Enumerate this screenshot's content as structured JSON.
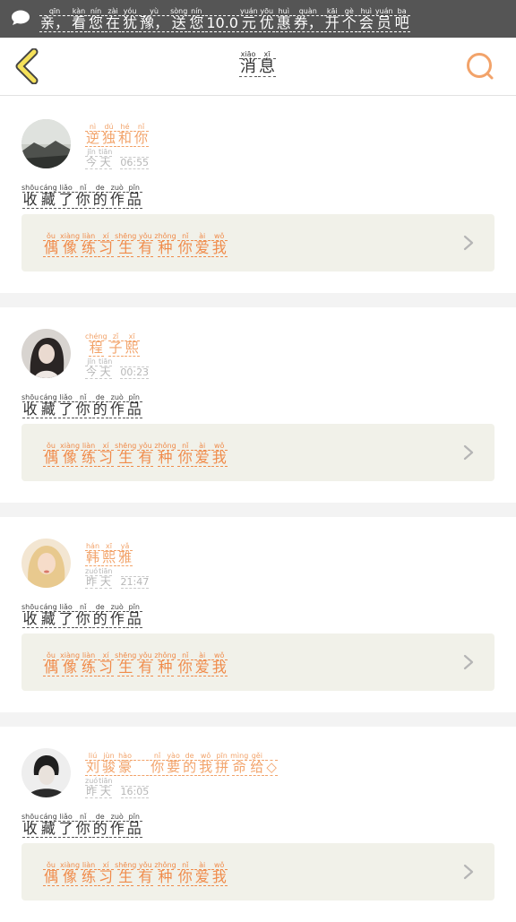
{
  "colors": {
    "topbar_bg": "#555555",
    "accent_orange": "#f08b4a",
    "back_arrow_yellow": "#f5e15a",
    "card_inner_bg": "#f1f1e9",
    "separator": "#f3f3f3"
  },
  "topbar": {
    "icon": "chat-bubble-icon",
    "text": [
      {
        "py": "qīn",
        "hz": "亲，"
      },
      {
        "py": "kàn",
        "hz": "看"
      },
      {
        "py": "nín",
        "hz": "您"
      },
      {
        "py": "zài",
        "hz": "在"
      },
      {
        "py": "yóu",
        "hz": "犹"
      },
      {
        "py": "yù",
        "hz": "豫，"
      },
      {
        "py": "sòng",
        "hz": "送"
      },
      {
        "py": "nín",
        "hz": "您"
      },
      {
        "py": "",
        "hz": "10.0"
      },
      {
        "py": "yuán",
        "hz": "元"
      },
      {
        "py": "yōu",
        "hz": "优"
      },
      {
        "py": "huì",
        "hz": "惠"
      },
      {
        "py": "quàn",
        "hz": "券，"
      },
      {
        "py": "kāi",
        "hz": "开"
      },
      {
        "py": "gè",
        "hz": "个"
      },
      {
        "py": "huì",
        "hz": "会"
      },
      {
        "py": "yuán",
        "hz": "员"
      },
      {
        "py": "ba",
        "hz": "吧"
      }
    ]
  },
  "header": {
    "back_icon": "back-chevron-icon",
    "search_icon": "search-icon",
    "title": [
      {
        "py": "xiāo",
        "hz": "消"
      },
      {
        "py": "xī",
        "hz": "息"
      }
    ]
  },
  "messages": [
    {
      "username": [
        {
          "py": "nì",
          "hz": "逆"
        },
        {
          "py": "dú",
          "hz": "独"
        },
        {
          "py": "hé",
          "hz": "和"
        },
        {
          "py": "nǐ",
          "hz": "你"
        }
      ],
      "day": [
        {
          "py": "jīn",
          "hz": "今"
        },
        {
          "py": "tiān",
          "hz": "天"
        }
      ],
      "time": "06:55",
      "action": [
        {
          "py": "shōu",
          "hz": "收"
        },
        {
          "py": "cáng",
          "hz": "藏"
        },
        {
          "py": "liǎo",
          "hz": "了"
        },
        {
          "py": "nǐ",
          "hz": "你"
        },
        {
          "py": "de",
          "hz": "的"
        },
        {
          "py": "zuò",
          "hz": "作"
        },
        {
          "py": "pǐn",
          "hz": "品"
        }
      ],
      "work": [
        {
          "py": "ǒu",
          "hz": "偶"
        },
        {
          "py": "xiàng",
          "hz": "像"
        },
        {
          "py": "liàn",
          "hz": "练"
        },
        {
          "py": "xí",
          "hz": "习"
        },
        {
          "py": "shēng",
          "hz": "生"
        },
        {
          "py": "yǒu",
          "hz": "有"
        },
        {
          "py": "zhǒng",
          "hz": "种"
        },
        {
          "py": "nǐ",
          "hz": "你"
        },
        {
          "py": "ài",
          "hz": "爱"
        },
        {
          "py": "wǒ",
          "hz": "我"
        }
      ]
    },
    {
      "username": [
        {
          "py": "chéng",
          "hz": "程"
        },
        {
          "py": "zǐ",
          "hz": "子"
        },
        {
          "py": "xī",
          "hz": "熙"
        }
      ],
      "day": [
        {
          "py": "jīn",
          "hz": "今"
        },
        {
          "py": "tiān",
          "hz": "天"
        }
      ],
      "time": "00:23",
      "action": [
        {
          "py": "shōu",
          "hz": "收"
        },
        {
          "py": "cáng",
          "hz": "藏"
        },
        {
          "py": "liǎo",
          "hz": "了"
        },
        {
          "py": "nǐ",
          "hz": "你"
        },
        {
          "py": "de",
          "hz": "的"
        },
        {
          "py": "zuò",
          "hz": "作"
        },
        {
          "py": "pǐn",
          "hz": "品"
        }
      ],
      "work": [
        {
          "py": "ǒu",
          "hz": "偶"
        },
        {
          "py": "xiàng",
          "hz": "像"
        },
        {
          "py": "liàn",
          "hz": "练"
        },
        {
          "py": "xí",
          "hz": "习"
        },
        {
          "py": "shēng",
          "hz": "生"
        },
        {
          "py": "yǒu",
          "hz": "有"
        },
        {
          "py": "zhǒng",
          "hz": "种"
        },
        {
          "py": "nǐ",
          "hz": "你"
        },
        {
          "py": "ài",
          "hz": "爱"
        },
        {
          "py": "wǒ",
          "hz": "我"
        }
      ]
    },
    {
      "username": [
        {
          "py": "hán",
          "hz": "韩"
        },
        {
          "py": "xī",
          "hz": "熙"
        },
        {
          "py": "yǎ",
          "hz": "雅"
        }
      ],
      "day": [
        {
          "py": "zuó",
          "hz": "昨"
        },
        {
          "py": "tiān",
          "hz": "天"
        }
      ],
      "time": "21:47",
      "action": [
        {
          "py": "shōu",
          "hz": "收"
        },
        {
          "py": "cáng",
          "hz": "藏"
        },
        {
          "py": "liǎo",
          "hz": "了"
        },
        {
          "py": "nǐ",
          "hz": "你"
        },
        {
          "py": "de",
          "hz": "的"
        },
        {
          "py": "zuò",
          "hz": "作"
        },
        {
          "py": "pǐn",
          "hz": "品"
        }
      ],
      "work": [
        {
          "py": "ǒu",
          "hz": "偶"
        },
        {
          "py": "xiàng",
          "hz": "像"
        },
        {
          "py": "liàn",
          "hz": "练"
        },
        {
          "py": "xí",
          "hz": "习"
        },
        {
          "py": "shēng",
          "hz": "生"
        },
        {
          "py": "yǒu",
          "hz": "有"
        },
        {
          "py": "zhǒng",
          "hz": "种"
        },
        {
          "py": "nǐ",
          "hz": "你"
        },
        {
          "py": "ài",
          "hz": "爱"
        },
        {
          "py": "wǒ",
          "hz": "我"
        }
      ]
    },
    {
      "username": [
        {
          "py": "liú",
          "hz": "刘"
        },
        {
          "py": "jùn",
          "hz": "骏"
        },
        {
          "py": "hào",
          "hz": "豪"
        },
        {
          "py": "",
          "hz": "　"
        },
        {
          "py": "nǐ",
          "hz": "你"
        },
        {
          "py": "yào",
          "hz": "要"
        },
        {
          "py": "de",
          "hz": "的"
        },
        {
          "py": "wǒ",
          "hz": "我"
        },
        {
          "py": "pīn",
          "hz": "拼"
        },
        {
          "py": "mìng",
          "hz": "命"
        },
        {
          "py": "gěi",
          "hz": "给"
        },
        {
          "py": "",
          "hz": "◇"
        }
      ],
      "day": [
        {
          "py": "zuó",
          "hz": "昨"
        },
        {
          "py": "tiān",
          "hz": "天"
        }
      ],
      "time": "16:05",
      "action": [
        {
          "py": "shōu",
          "hz": "收"
        },
        {
          "py": "cáng",
          "hz": "藏"
        },
        {
          "py": "liǎo",
          "hz": "了"
        },
        {
          "py": "nǐ",
          "hz": "你"
        },
        {
          "py": "de",
          "hz": "的"
        },
        {
          "py": "zuò",
          "hz": "作"
        },
        {
          "py": "pǐn",
          "hz": "品"
        }
      ],
      "work": [
        {
          "py": "ǒu",
          "hz": "偶"
        },
        {
          "py": "xiàng",
          "hz": "像"
        },
        {
          "py": "liàn",
          "hz": "练"
        },
        {
          "py": "xí",
          "hz": "习"
        },
        {
          "py": "shēng",
          "hz": "生"
        },
        {
          "py": "yǒu",
          "hz": "有"
        },
        {
          "py": "zhǒng",
          "hz": "种"
        },
        {
          "py": "nǐ",
          "hz": "你"
        },
        {
          "py": "ài",
          "hz": "爱"
        },
        {
          "py": "wǒ",
          "hz": "我"
        }
      ]
    }
  ]
}
